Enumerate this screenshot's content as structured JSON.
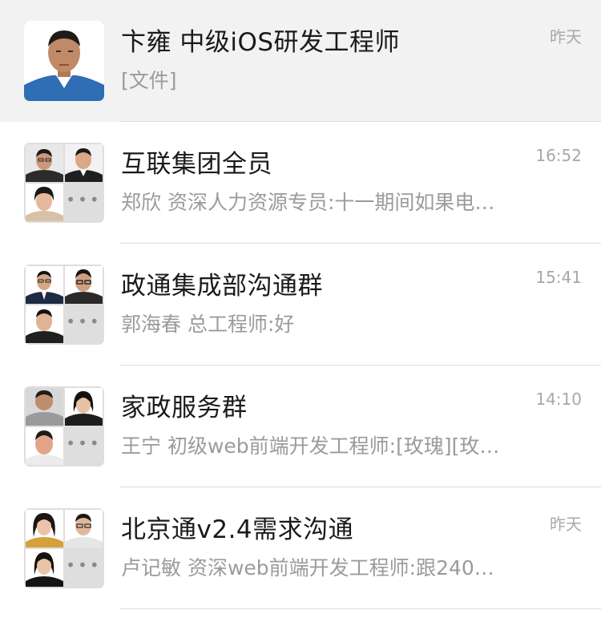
{
  "chats": [
    {
      "title": "卞雍 中级iOS研发工程师",
      "preview": "[文件]",
      "time": "昨天",
      "pinned": true,
      "avatar_type": "single"
    },
    {
      "title": "互联集团全员",
      "preview": "郑欣 资深人力资源专员:十一期间如果电…",
      "time": "16:52",
      "pinned": false,
      "avatar_type": "group"
    },
    {
      "title": "政通集成部沟通群",
      "preview": "郭海春 总工程师:好",
      "time": "15:41",
      "pinned": false,
      "avatar_type": "group"
    },
    {
      "title": "家政服务群",
      "preview": "王宁 初级web前端开发工程师:[玫瑰][玫…",
      "time": "14:10",
      "pinned": false,
      "avatar_type": "group"
    },
    {
      "title": "北京通v2.4需求沟通",
      "preview": "卢记敏 资深web前端开发工程师:跟240…",
      "time": "昨天",
      "pinned": false,
      "avatar_type": "group"
    }
  ],
  "group_more_glyph": "•••",
  "colors": {
    "pinned_background": "#f2f2f2",
    "title": "#1a1a1a",
    "preview": "#9b9b9b",
    "time": "#a8a8a8",
    "divider": "#dcdcdc"
  }
}
